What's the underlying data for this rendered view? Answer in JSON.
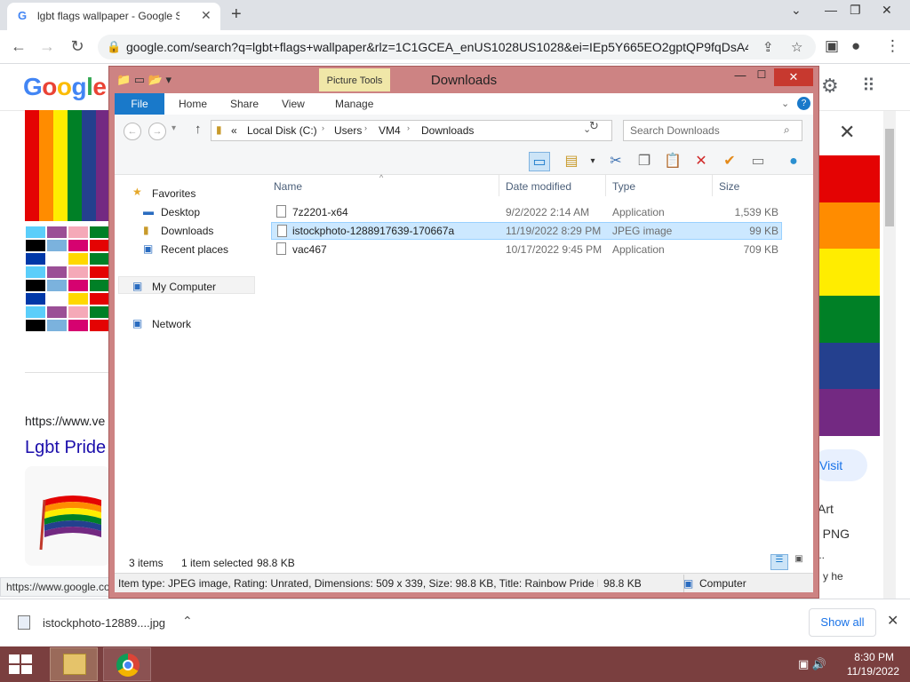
{
  "browser": {
    "tab_title": "lgbt flags wallpaper - Google Se",
    "url": "google.com/search?q=lgbt+flags+wallpaper&rlz=1C1GCEA_enUS1028US1028&ei=IEp5Y665EO2gptQP9fqDsA4...",
    "status_url": "https://www.google.co"
  },
  "google": {
    "logo": [
      "G",
      "o",
      "o",
      "g",
      "l",
      "e"
    ],
    "logo_colors": [
      "#4285f4",
      "#ea4335",
      "#fbbc05",
      "#4285f4",
      "#34a853",
      "#ea4335"
    ],
    "result_url": "https://www.ve",
    "result_title": "Lgbt Pride",
    "visit_label": "Visit",
    "side_text": [
      "Art",
      "e PNG",
      "...",
      "y he"
    ],
    "flag_colors": [
      "#e40303",
      "#ff8c00",
      "#ffed00",
      "#008026",
      "#24408e",
      "#732982"
    ]
  },
  "explorer": {
    "title": "Downloads",
    "picture_tools": "Picture Tools",
    "ribbon_tabs": [
      "File",
      "Home",
      "Share",
      "View",
      "Manage"
    ],
    "breadcrumb": [
      "«",
      "Local Disk (C:)",
      "Users",
      "VM4",
      "Downloads"
    ],
    "search_placeholder": "Search Downloads",
    "nav": {
      "favorites": "Favorites",
      "desktop": "Desktop",
      "downloads": "Downloads",
      "recent": "Recent places",
      "my_computer": "My Computer",
      "network": "Network"
    },
    "columns": [
      "Name",
      "Date modified",
      "Type",
      "Size"
    ],
    "files": [
      {
        "name": "7z2201-x64",
        "date": "9/2/2022 2:14 AM",
        "type": "Application",
        "size": "1,539 KB",
        "selected": false
      },
      {
        "name": "istockphoto-1288917639-170667a",
        "date": "11/19/2022 8:29 PM",
        "type": "JPEG image",
        "size": "99 KB",
        "selected": true
      },
      {
        "name": "vac467",
        "date": "10/17/2022 9:45 PM",
        "type": "Application",
        "size": "709 KB",
        "selected": false
      }
    ],
    "status": {
      "items": "3 items",
      "selected": "1 item selected",
      "selected_size": "98.8 KB"
    },
    "details": {
      "info": "Item type: JPEG image, Rating: Unrated, Dimensions: 509 x 339, Size: 98.8 KB, Title: Rainbow Pride Flag B",
      "size": "98.8 KB",
      "location": "Computer"
    }
  },
  "downloads_bar": {
    "file": "istockphoto-12889....jpg",
    "show_all": "Show all"
  },
  "taskbar": {
    "time": "8:30 PM",
    "date": "11/19/2022"
  },
  "colors": {
    "explorer_frame": "#cd8383",
    "taskbar": "#7a3f3f",
    "selection": "#cce8ff",
    "file_tab": "#1979ca"
  }
}
